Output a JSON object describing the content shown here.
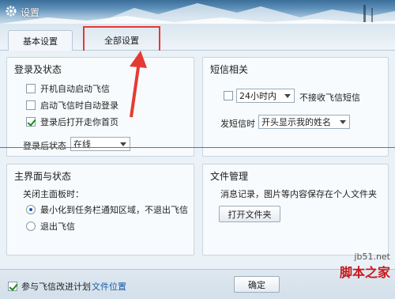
{
  "window": {
    "title": "设置",
    "icon": "gear-icon"
  },
  "tabs": {
    "basic": "基本设置",
    "all": "全部设置"
  },
  "login": {
    "title": "登录及状态",
    "options": [
      {
        "label": "开机自动启动飞信",
        "checked": false
      },
      {
        "label": "启动飞信时自动登录",
        "checked": false
      },
      {
        "label": "登录后打开走你首页",
        "checked": true
      }
    ],
    "status_label": "登录后状态",
    "status_value": "在线"
  },
  "sms": {
    "title": "短信相关",
    "period_value": "24小时内",
    "block_label": "不接收飞信短信",
    "send_label": "发短信时",
    "send_value": "开头显示我的姓名"
  },
  "main_ui": {
    "title": "主界面与状态",
    "close_label": "关闭主面板时：",
    "options": [
      {
        "label": "最小化到任务栏通知区域，不退出飞信",
        "checked": true
      },
      {
        "label": "退出飞信",
        "checked": false
      }
    ]
  },
  "files": {
    "title": "文件管理",
    "desc": "消息记录，图片等内容保存在个人文件夹",
    "open_button": "打开文件夹"
  },
  "footer": {
    "improve_label": "参与飞信改进计划",
    "improve_checked": true,
    "file_location": "文件位置",
    "confirm": "确定"
  },
  "watermark": {
    "url": "jb51.net",
    "name": "脚本之家"
  },
  "colors": {
    "highlight": "#e53a33",
    "link": "#1a5aa8",
    "check": "#1a8a1a"
  }
}
